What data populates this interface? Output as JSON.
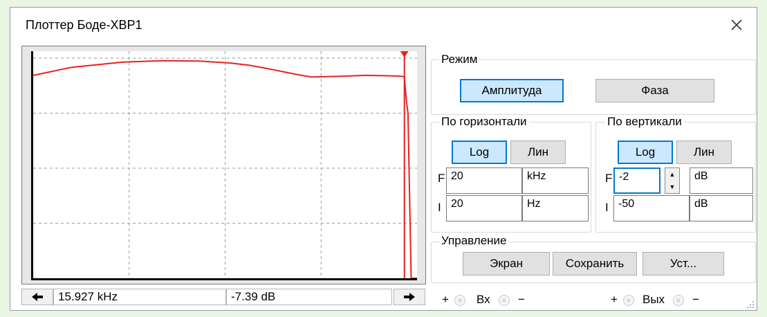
{
  "window": {
    "title": "Плоттер Боде-XBP1"
  },
  "status": {
    "frequency": "15.927 kHz",
    "value": "-7.39 dB"
  },
  "mode": {
    "label": "Режим",
    "amplitude_label": "Амплитуда",
    "phase_label": "Фаза",
    "active": "amplitude"
  },
  "horizontal": {
    "label": "По горизонтали",
    "log_label": "Log",
    "lin_label": "Лин",
    "active": "log",
    "final_label": "F",
    "final_value": "20",
    "final_unit": "kHz",
    "initial_label": "I",
    "initial_value": "20",
    "initial_unit": "Hz"
  },
  "vertical": {
    "label": "По вертикали",
    "log_label": "Log",
    "lin_label": "Лин",
    "active": "log",
    "final_label": "F",
    "final_value": "-2",
    "final_unit": "dB",
    "initial_label": "I",
    "initial_value": "-50",
    "initial_unit": "dB"
  },
  "control": {
    "label": "Управление",
    "screen_label": "Экран",
    "save_label": "Сохранить",
    "settings_label": "Уст..."
  },
  "terminals": {
    "plus": "+",
    "minus": "−",
    "in_label": "Вх",
    "out_label": "Вых"
  },
  "icons": {
    "close": "close-icon",
    "left": "arrow-left-icon",
    "right": "arrow-right-icon",
    "spin_up": "spin-up-icon",
    "spin_down": "spin-down-icon",
    "grip": "resize-grip-icon"
  },
  "colors": {
    "trace": "#e8201e",
    "accent": "#0078d7",
    "active_bg": "#cce8ff"
  },
  "chart_data": {
    "type": "line",
    "x_scale": "log",
    "xlim": [
      20,
      20000
    ],
    "ylim": [
      -50,
      -2
    ],
    "grid": true,
    "cursor_x": 15927,
    "cursor_y": -7.39,
    "series": [
      {
        "x": [
          20,
          40,
          100,
          200,
          400,
          700,
          1000,
          1500,
          2000,
          2500,
          3000,
          5000,
          8000,
          10000,
          12000,
          14000,
          15000,
          15500,
          15800,
          15927,
          16200,
          16600,
          17000,
          18000,
          19000,
          20000
        ],
        "y": [
          -7.1,
          -5.4,
          -4.3,
          -4.0,
          -4.1,
          -4.5,
          -5.0,
          -5.9,
          -6.6,
          -7.1,
          -7.45,
          -7.3,
          -7.1,
          -7.15,
          -7.2,
          -7.25,
          -7.3,
          -7.35,
          -7.4,
          -7.39,
          -10.0,
          -13.0,
          -15.0,
          -50.0,
          -50.0,
          -50.0
        ]
      }
    ]
  }
}
